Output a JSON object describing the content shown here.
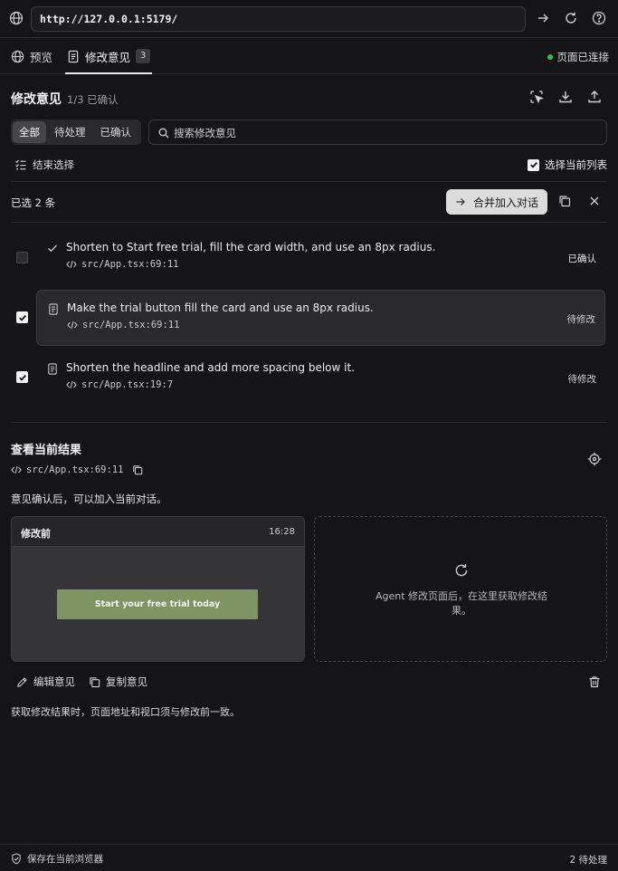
{
  "browser": {
    "url": "http://127.0.0.1:5179/"
  },
  "tabs": [
    {
      "label": "预览",
      "icon": "globe-icon"
    },
    {
      "label": "修改意见",
      "icon": "document-icon",
      "count": "3"
    }
  ],
  "connection": {
    "label": "页面已连接",
    "color": "#27c25a"
  },
  "header": {
    "title": "修改意见",
    "confirmed": "1/3 已确认"
  },
  "filters": {
    "options": [
      "全部",
      "待处理",
      "已确认"
    ],
    "selected": "全部"
  },
  "search": {
    "placeholder": "搜索修改意见"
  },
  "selection": {
    "end_label": "结束选择",
    "select_list_label": "选择当前列表",
    "count_label": "已选 2 条",
    "merge_label": "合并加入对话"
  },
  "items": [
    {
      "text": "Shorten to Start free trial, fill the card width, and use an 8px radius.",
      "path": "src/App.tsx:69:11",
      "status": "已确认",
      "checked": false,
      "icon": "check-icon"
    },
    {
      "text": "Make the trial button fill the card and use an 8px radius.",
      "path": "src/App.tsx:69:11",
      "status": "待修改",
      "checked": true,
      "icon": "document-icon"
    },
    {
      "text": "Shorten the headline and add more spacing below it.",
      "path": "src/App.tsx:19:7",
      "status": "待修改",
      "checked": true,
      "icon": "document-icon"
    }
  ],
  "result": {
    "title": "查看当前结果",
    "path": "src/App.tsx:69:11",
    "note": "意见确认后，可以加入当前对话。",
    "before_label": "修改前",
    "before_time": "16:28",
    "preview_button": "Start your free trial today",
    "preview_button_color": "#7e9563",
    "after_placeholder": "Agent 修改页面后，在这里获取修改结果。",
    "edit_label": "编辑意见",
    "copy_label": "复制意见",
    "footnote": "获取修改结果时，页面地址和视口须与修改前一致。"
  },
  "footer": {
    "left": "保存在当前浏览器",
    "right": "2 待处理"
  }
}
